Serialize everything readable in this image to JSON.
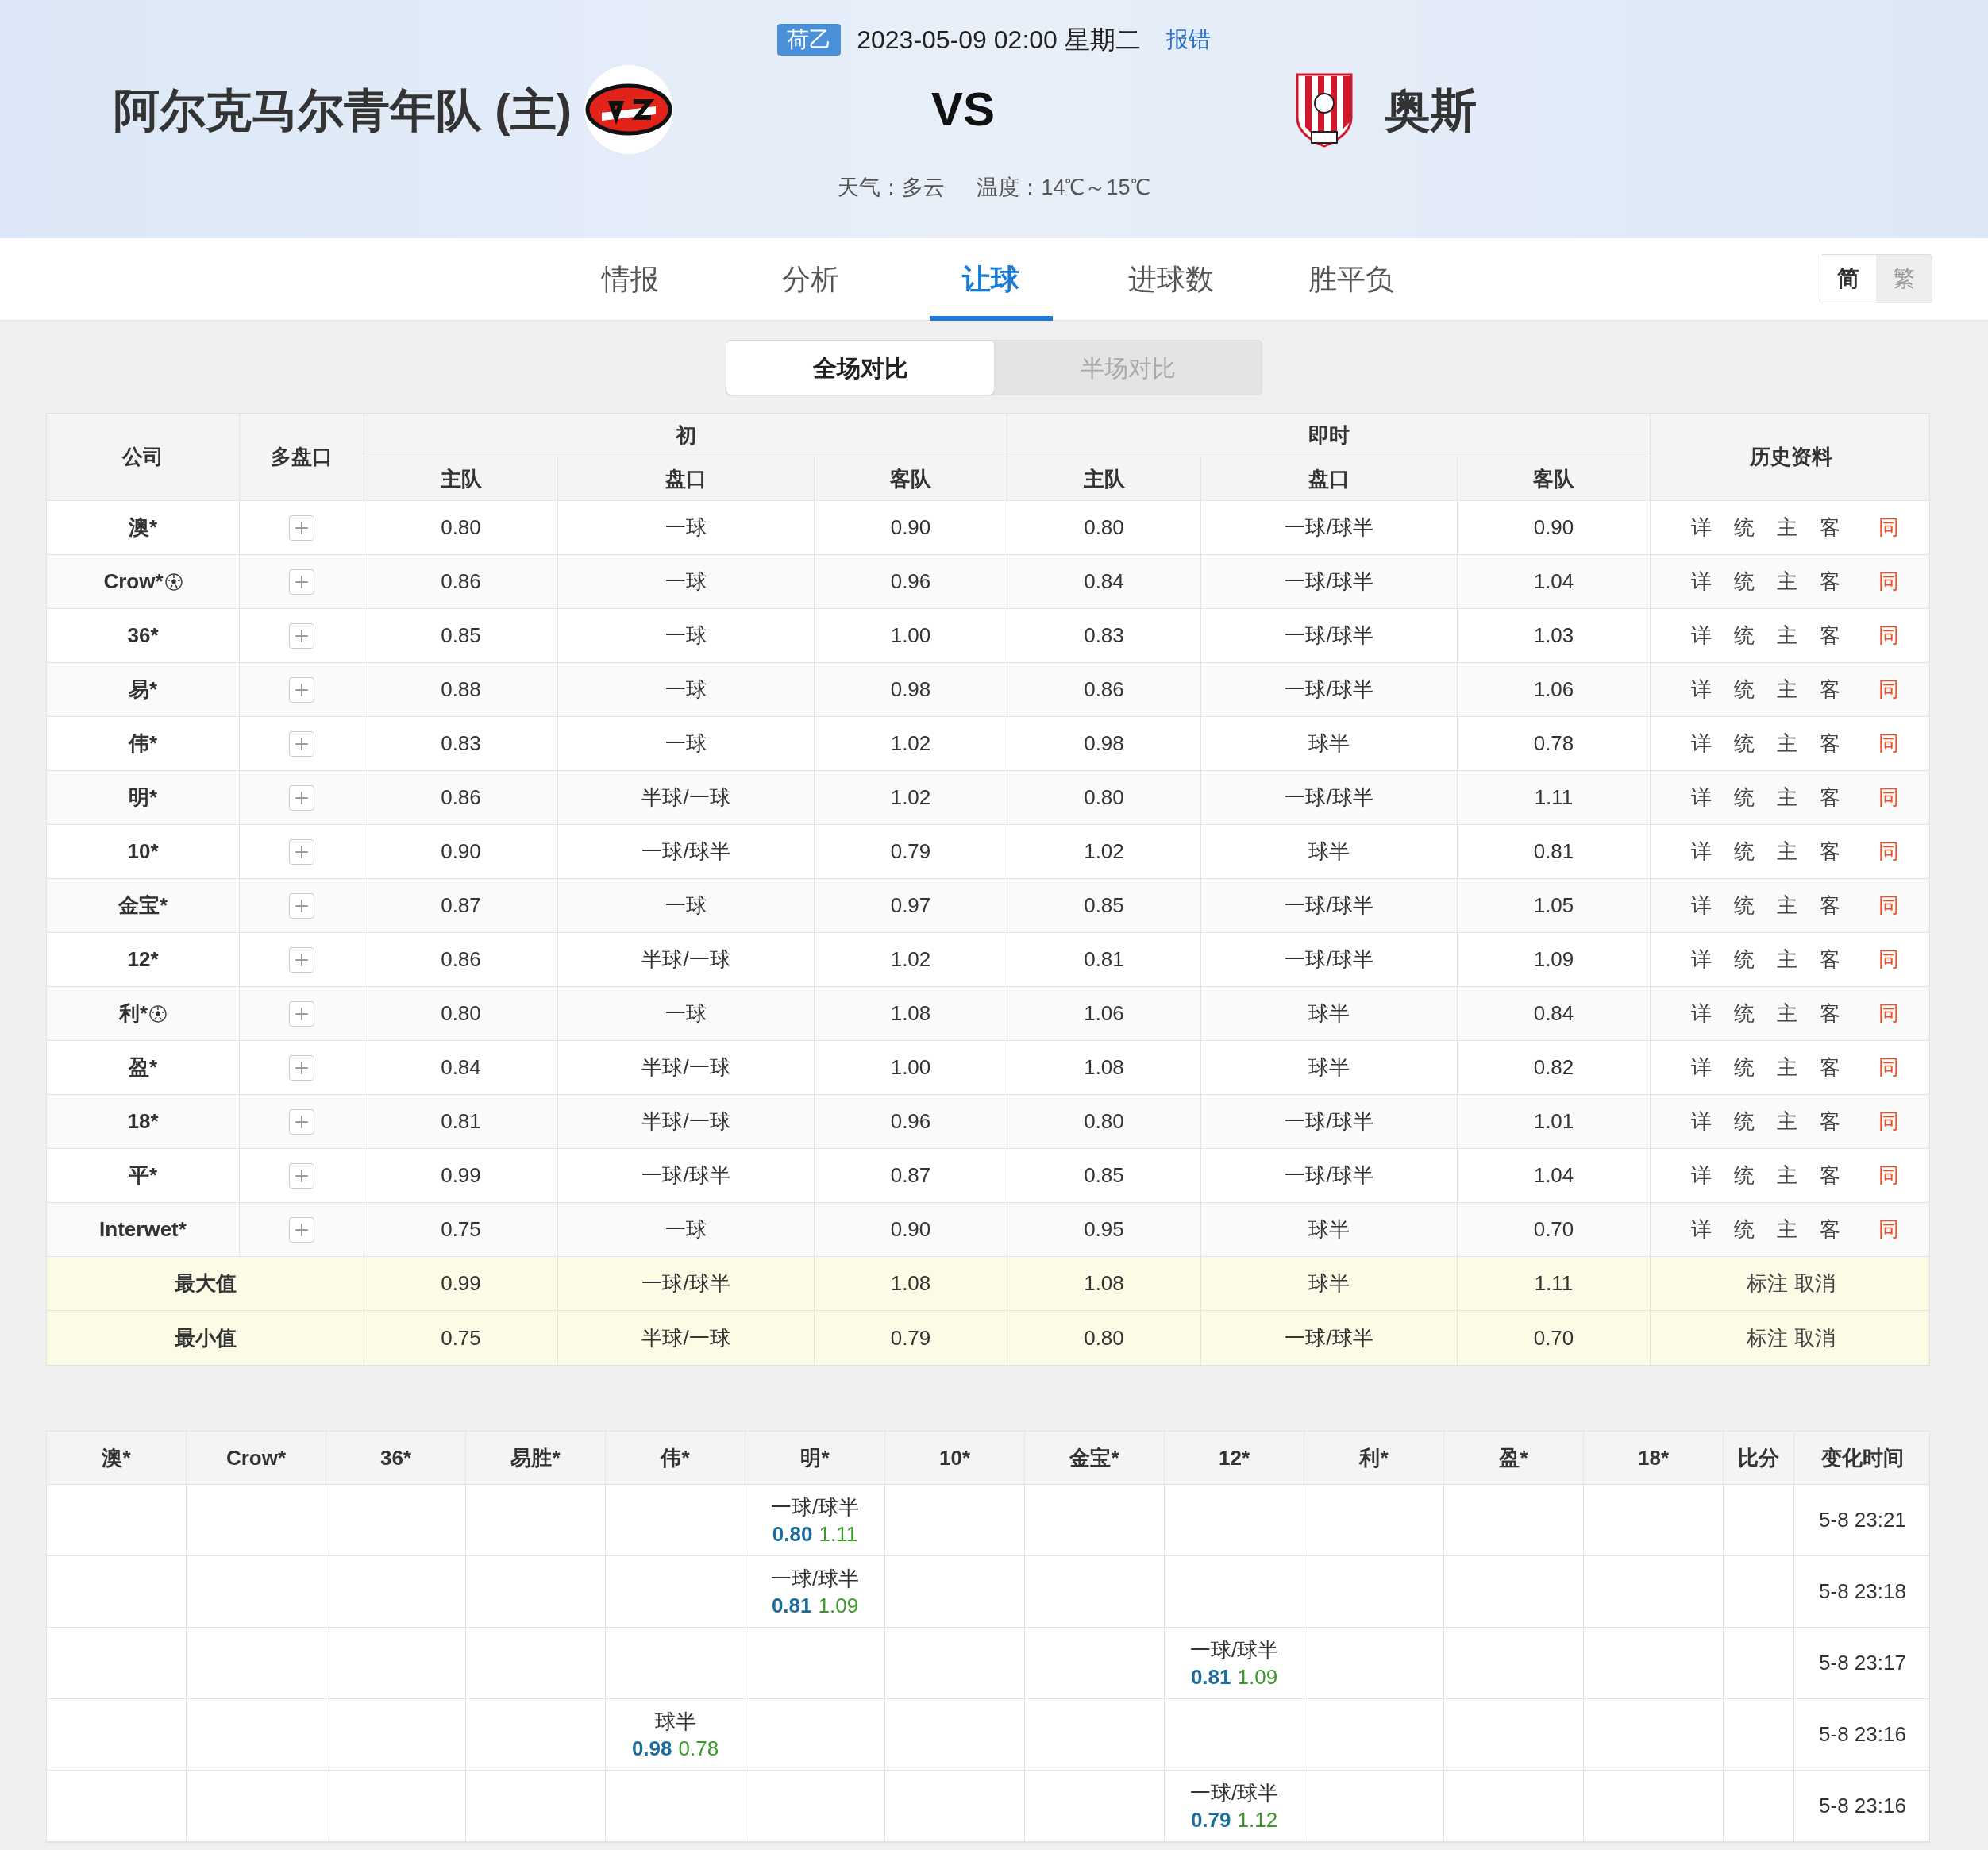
{
  "match": {
    "league": "荷乙",
    "datetime": "2023-05-09 02:00 星期二",
    "report": "报错",
    "home": "阿尔克马尔青年队 (主)",
    "vs": "VS",
    "away": "奥斯",
    "weather": "天气：多云",
    "temperature": "温度：14℃～15℃"
  },
  "tabs": [
    {
      "label": "情报",
      "selected": false
    },
    {
      "label": "分析",
      "selected": false
    },
    {
      "label": "让球",
      "selected": true
    },
    {
      "label": "进球数",
      "selected": false
    },
    {
      "label": "胜平负",
      "selected": false
    }
  ],
  "script_toggle": [
    {
      "label": "简",
      "selected": true
    },
    {
      "label": "繁",
      "selected": false
    }
  ],
  "compare_toggle": [
    {
      "label": "全场对比",
      "selected": true
    },
    {
      "label": "半场对比",
      "selected": false
    }
  ],
  "odds_table": {
    "headers": {
      "company": "公司",
      "multi": "多盘口",
      "initial": "初",
      "live": "即时",
      "history": "历史资料",
      "sub_headers": [
        "主队",
        "盘口",
        "客队",
        "主队",
        "盘口",
        "客队"
      ]
    },
    "rows": [
      {
        "company": "澳*",
        "ball": false,
        "values": [
          "0.80",
          "一球",
          "0.90",
          "0.80",
          "一球/球半",
          "0.90"
        ],
        "links": [
          {
            "label": "详",
            "highlight": false
          },
          {
            "label": "统",
            "highlight": false
          },
          {
            "label": "主",
            "highlight": false
          },
          {
            "label": "客",
            "highlight": false
          },
          {
            "label": "同",
            "highlight": true
          }
        ]
      },
      {
        "company": "Crow*",
        "ball": true,
        "values": [
          "0.86",
          "一球",
          "0.96",
          "0.84",
          "一球/球半",
          "1.04"
        ],
        "links": [
          {
            "label": "详",
            "highlight": false
          },
          {
            "label": "统",
            "highlight": false
          },
          {
            "label": "主",
            "highlight": false
          },
          {
            "label": "客",
            "highlight": false
          },
          {
            "label": "同",
            "highlight": true
          }
        ]
      },
      {
        "company": "36*",
        "ball": false,
        "values": [
          "0.85",
          "一球",
          "1.00",
          "0.83",
          "一球/球半",
          "1.03"
        ],
        "links": [
          {
            "label": "详",
            "highlight": false
          },
          {
            "label": "统",
            "highlight": false
          },
          {
            "label": "主",
            "highlight": false
          },
          {
            "label": "客",
            "highlight": false
          },
          {
            "label": "同",
            "highlight": true
          }
        ]
      },
      {
        "company": "易*",
        "ball": false,
        "values": [
          "0.88",
          "一球",
          "0.98",
          "0.86",
          "一球/球半",
          "1.06"
        ],
        "links": [
          {
            "label": "详",
            "highlight": false
          },
          {
            "label": "统",
            "highlight": false
          },
          {
            "label": "主",
            "highlight": false
          },
          {
            "label": "客",
            "highlight": false
          },
          {
            "label": "同",
            "highlight": true
          }
        ]
      },
      {
        "company": "伟*",
        "ball": false,
        "values": [
          "0.83",
          "一球",
          "1.02",
          "0.98",
          "球半",
          "0.78"
        ],
        "links": [
          {
            "label": "详",
            "highlight": false
          },
          {
            "label": "统",
            "highlight": false
          },
          {
            "label": "主",
            "highlight": false
          },
          {
            "label": "客",
            "highlight": false
          },
          {
            "label": "同",
            "highlight": true
          }
        ]
      },
      {
        "company": "明*",
        "ball": false,
        "values": [
          "0.86",
          "半球/一球",
          "1.02",
          "0.80",
          "一球/球半",
          "1.11"
        ],
        "links": [
          {
            "label": "详",
            "highlight": false
          },
          {
            "label": "统",
            "highlight": false
          },
          {
            "label": "主",
            "highlight": false
          },
          {
            "label": "客",
            "highlight": false
          },
          {
            "label": "同",
            "highlight": true
          }
        ]
      },
      {
        "company": "10*",
        "ball": false,
        "values": [
          "0.90",
          "一球/球半",
          "0.79",
          "1.02",
          "球半",
          "0.81"
        ],
        "links": [
          {
            "label": "详",
            "highlight": false
          },
          {
            "label": "统",
            "highlight": false
          },
          {
            "label": "主",
            "highlight": false
          },
          {
            "label": "客",
            "highlight": false
          },
          {
            "label": "同",
            "highlight": true
          }
        ]
      },
      {
        "company": "金宝*",
        "ball": false,
        "values": [
          "0.87",
          "一球",
          "0.97",
          "0.85",
          "一球/球半",
          "1.05"
        ],
        "links": [
          {
            "label": "详",
            "highlight": false
          },
          {
            "label": "统",
            "highlight": false
          },
          {
            "label": "主",
            "highlight": false
          },
          {
            "label": "客",
            "highlight": false
          },
          {
            "label": "同",
            "highlight": true
          }
        ]
      },
      {
        "company": "12*",
        "ball": false,
        "values": [
          "0.86",
          "半球/一球",
          "1.02",
          "0.81",
          "一球/球半",
          "1.09"
        ],
        "links": [
          {
            "label": "详",
            "highlight": false
          },
          {
            "label": "统",
            "highlight": false
          },
          {
            "label": "主",
            "highlight": false
          },
          {
            "label": "客",
            "highlight": false
          },
          {
            "label": "同",
            "highlight": true
          }
        ]
      },
      {
        "company": "利*",
        "ball": true,
        "values": [
          "0.80",
          "一球",
          "1.08",
          "1.06",
          "球半",
          "0.84"
        ],
        "links": [
          {
            "label": "详",
            "highlight": false
          },
          {
            "label": "统",
            "highlight": false
          },
          {
            "label": "主",
            "highlight": false
          },
          {
            "label": "客",
            "highlight": false
          },
          {
            "label": "同",
            "highlight": true
          }
        ]
      },
      {
        "company": "盈*",
        "ball": false,
        "values": [
          "0.84",
          "半球/一球",
          "1.00",
          "1.08",
          "球半",
          "0.82"
        ],
        "links": [
          {
            "label": "详",
            "highlight": false
          },
          {
            "label": "统",
            "highlight": false
          },
          {
            "label": "主",
            "highlight": false
          },
          {
            "label": "客",
            "highlight": false
          },
          {
            "label": "同",
            "highlight": true
          }
        ]
      },
      {
        "company": "18*",
        "ball": false,
        "values": [
          "0.81",
          "半球/一球",
          "0.96",
          "0.80",
          "一球/球半",
          "1.01"
        ],
        "links": [
          {
            "label": "详",
            "highlight": false
          },
          {
            "label": "统",
            "highlight": false
          },
          {
            "label": "主",
            "highlight": false
          },
          {
            "label": "客",
            "highlight": false
          },
          {
            "label": "同",
            "highlight": true
          }
        ]
      },
      {
        "company": "平*",
        "ball": false,
        "values": [
          "0.99",
          "一球/球半",
          "0.87",
          "0.85",
          "一球/球半",
          "1.04"
        ],
        "links": [
          {
            "label": "详",
            "highlight": false
          },
          {
            "label": "统",
            "highlight": false
          },
          {
            "label": "主",
            "highlight": false
          },
          {
            "label": "客",
            "highlight": false
          },
          {
            "label": "同",
            "highlight": true
          }
        ]
      },
      {
        "company": "Interwet*",
        "ball": false,
        "values": [
          "0.75",
          "一球",
          "0.90",
          "0.95",
          "球半",
          "0.70"
        ],
        "links": [
          {
            "label": "详",
            "highlight": false
          },
          {
            "label": "统",
            "highlight": false
          },
          {
            "label": "主",
            "highlight": false
          },
          {
            "label": "客",
            "highlight": false
          },
          {
            "label": "同",
            "highlight": true
          }
        ]
      }
    ],
    "summary": [
      {
        "label": "最大值",
        "values": [
          "0.99",
          "一球/球半",
          "1.08",
          "1.08",
          "球半",
          "1.11"
        ],
        "actions": [
          "标注",
          "取消"
        ]
      },
      {
        "label": "最小值",
        "values": [
          "0.75",
          "半球/一球",
          "0.79",
          "0.80",
          "一球/球半",
          "0.70"
        ],
        "actions": [
          "标注",
          "取消"
        ]
      }
    ]
  },
  "changes_table": {
    "columns": [
      "澳*",
      "Crow*",
      "36*",
      "易胜*",
      "伟*",
      "明*",
      "10*",
      "金宝*",
      "12*",
      "利*",
      "盈*",
      "18*",
      "比分",
      "变化时间"
    ],
    "rows": [
      {
        "cells": [
          {},
          {},
          {},
          {},
          {},
          {
            "line": "一球/球半",
            "home": "0.80",
            "away": "1.11"
          },
          {},
          {},
          {},
          {},
          {},
          {}
        ],
        "time": "5-8 23:21"
      },
      {
        "cells": [
          {},
          {},
          {},
          {},
          {},
          {
            "line": "一球/球半",
            "home": "0.81",
            "away": "1.09"
          },
          {},
          {},
          {},
          {},
          {},
          {}
        ],
        "time": "5-8 23:18"
      },
      {
        "cells": [
          {},
          {},
          {},
          {},
          {},
          {},
          {},
          {},
          {
            "line": "一球/球半",
            "home": "0.81",
            "away": "1.09"
          },
          {},
          {},
          {}
        ],
        "time": "5-8 23:17"
      },
      {
        "cells": [
          {},
          {},
          {},
          {},
          {
            "line": "球半",
            "home": "0.98",
            "away": "0.78"
          },
          {},
          {},
          {},
          {},
          {},
          {},
          {}
        ],
        "time": "5-8 23:16"
      },
      {
        "cells": [
          {},
          {},
          {},
          {},
          {},
          {},
          {},
          {},
          {
            "line": "一球/球半",
            "home": "0.79",
            "away": "1.12"
          },
          {},
          {},
          {}
        ],
        "time": "5-8 23:16"
      }
    ]
  }
}
